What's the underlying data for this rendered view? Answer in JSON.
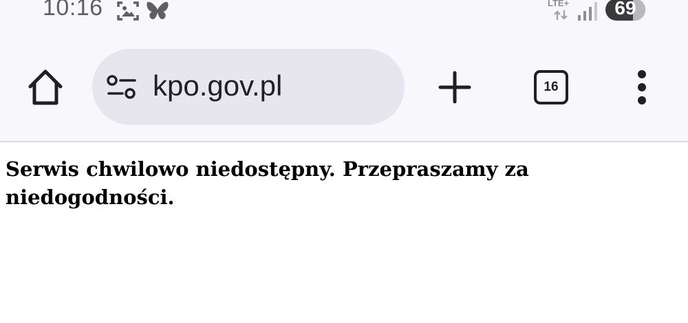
{
  "status_bar": {
    "time": "10:16",
    "network": "LTE+",
    "battery": "69",
    "battery_level": 0.69,
    "icons": [
      "screenshot-icon",
      "butterfly-icon",
      "data-arrows-icon",
      "signal-icon",
      "battery-icon"
    ]
  },
  "toolbar": {
    "url": "kpo.gov.pl",
    "tab_count": "16",
    "icons": [
      "home-icon",
      "site-settings-icon",
      "plus-icon",
      "tab-switcher-icon",
      "more-vert-icon"
    ]
  },
  "colors": {
    "toolbar_bg": "#f8f7fc",
    "omnibox_bg": "#e7e6ee",
    "icon": "#1f1f24",
    "status_text": "#5f5e63",
    "page_bg": "#ffffff",
    "text": "#000000"
  },
  "page": {
    "message": "Serwis chwilowo niedostępny. Przepraszamy za niedogodności."
  }
}
